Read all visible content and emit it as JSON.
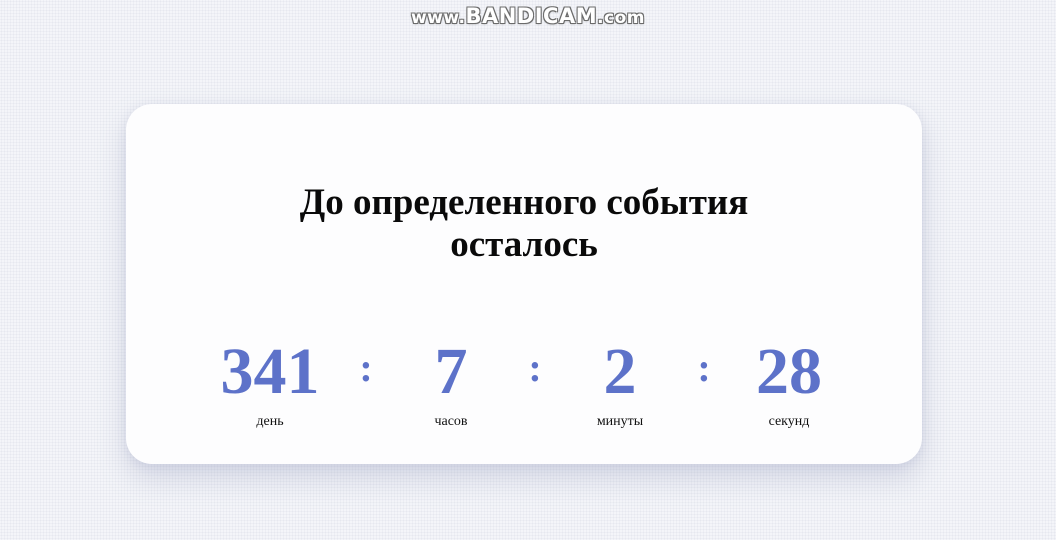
{
  "watermark": {
    "prefix": "www.",
    "brand": "BANDICAM",
    "suffix": ".com"
  },
  "countdown": {
    "title_line1": "До определенного события",
    "title_line2": "осталось",
    "separator": ":",
    "units": [
      {
        "value": "341",
        "label": "день"
      },
      {
        "value": "7",
        "label": "часов"
      },
      {
        "value": "2",
        "label": "минуты"
      },
      {
        "value": "28",
        "label": "секунд"
      }
    ]
  },
  "colors": {
    "accent": "#5d72c9",
    "card": "#fdfdfe",
    "text": "#0a0a0a"
  }
}
